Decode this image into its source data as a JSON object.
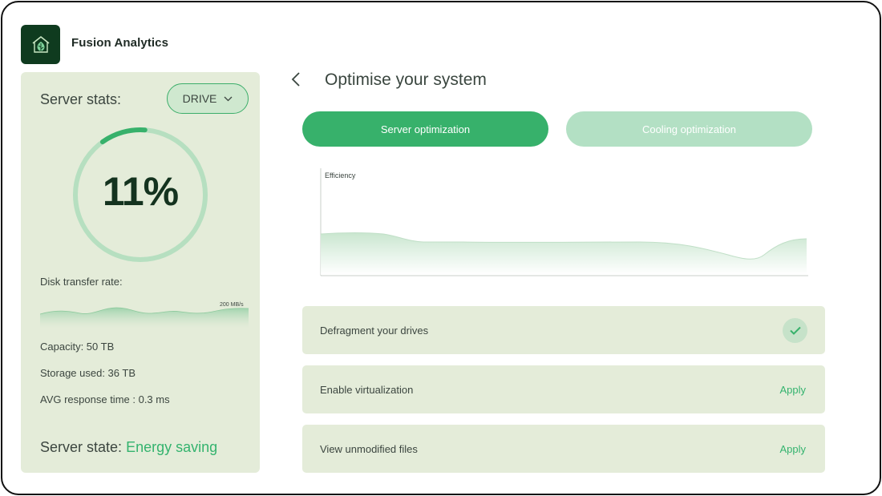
{
  "app": {
    "title": "Fusion Analytics",
    "logo_icon": "leaf-house-logo"
  },
  "stats": {
    "title": "Server stats:",
    "dropdown": {
      "selected": "DRIVE"
    },
    "gauge": {
      "value_text": "11%",
      "fraction": 0.11
    },
    "transfer": {
      "label": "Disk transfer rate:",
      "value": "200 MB/s"
    },
    "capacity": "Capacity: 50 TB",
    "storage_used": "Storage used: 36 TB",
    "avg_response": "AVG response time : 0.3 ms",
    "server_state": {
      "label": "Server state:",
      "value": "Energy saving"
    }
  },
  "main": {
    "title": "Optimise your system",
    "tabs": [
      {
        "label": "Server optimization",
        "active": true
      },
      {
        "label": "Cooling optimization",
        "active": false
      }
    ],
    "chart_label": "Efficiency",
    "tasks": [
      {
        "label": "Defragment your drives",
        "status": "done"
      },
      {
        "label": "Enable virtualization",
        "action": "Apply"
      },
      {
        "label": "View unmodified files",
        "action": "Apply"
      }
    ]
  },
  "colors": {
    "accent": "#37b16b",
    "panel": "#e4ecd9",
    "logo_bg": "#0f3b1f"
  }
}
